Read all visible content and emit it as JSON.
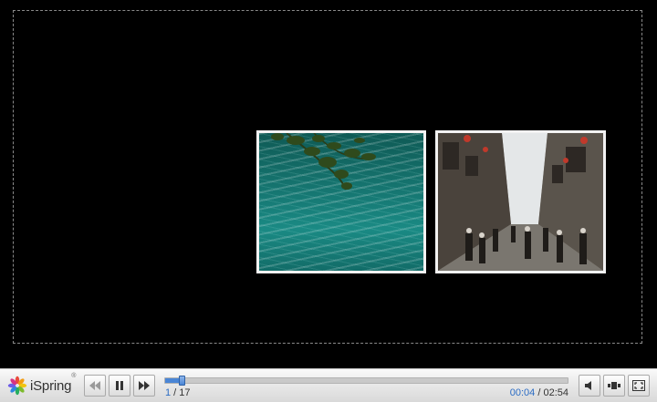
{
  "player": {
    "brand": "iSpring",
    "brand_mark": "®",
    "slide_current": "1",
    "slide_separator": " / ",
    "slide_total": "17",
    "time_current": "00:04",
    "time_separator": " / ",
    "time_total": "02:54",
    "progress_fraction": 0.023
  },
  "controls": {
    "rewind": "rewind-icon",
    "pause": "pause-icon",
    "forward": "fast-forward-icon",
    "volume": "speaker-icon",
    "layout": "layout-icon",
    "fullscreen": "fullscreen-icon"
  },
  "slide": {
    "images": [
      "water-with-branches-photo",
      "old-town-street-photo"
    ]
  }
}
